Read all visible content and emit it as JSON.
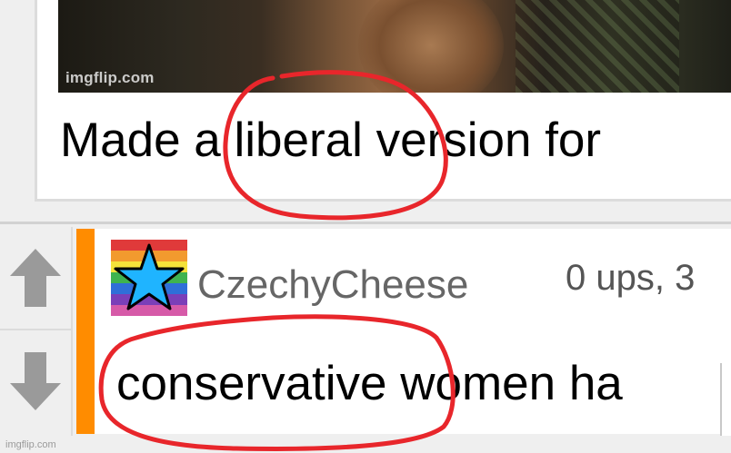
{
  "post": {
    "watermark": "imgflip.com",
    "caption": "Made a liberal version for"
  },
  "comment": {
    "username": "CzechyCheese",
    "stats": "0 ups, 3",
    "text": "conservative women ha"
  },
  "footer": {
    "watermark": "imgflip.com"
  },
  "icons": {
    "upvote": "arrow-up-icon",
    "downvote": "arrow-down-icon",
    "avatar": "rainbow-star-avatar"
  },
  "colors": {
    "accent": "#ff8c00",
    "annotation": "#e8262b",
    "vote_arrow": "#9a9a9a",
    "avatar_star": "#1fb4ff"
  }
}
